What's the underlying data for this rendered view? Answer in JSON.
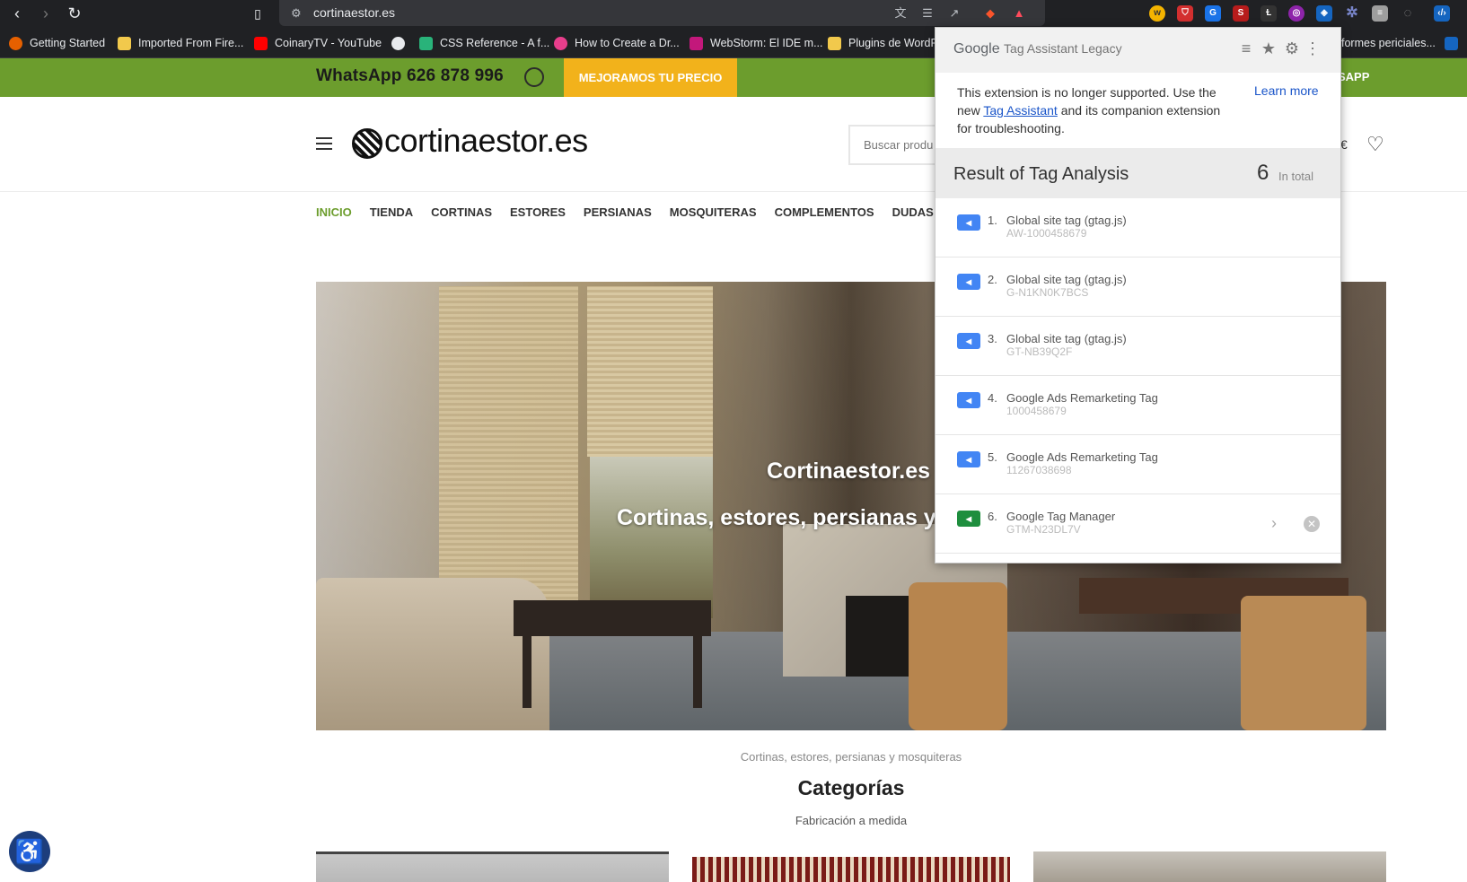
{
  "browser": {
    "url": "cortinaestor.es",
    "bookmarks": [
      {
        "label": "Getting Started",
        "color": "#e66000"
      },
      {
        "label": "Imported From Fire...",
        "color": "#f2c94c"
      },
      {
        "label": "CoinaryTV - YouTube",
        "color": "#ff0000"
      },
      {
        "label": "",
        "color": "#e8eaed"
      },
      {
        "label": "CSS Reference - A f...",
        "color": "#29b37a"
      },
      {
        "label": "How to Create a Dr...",
        "color": "#e83e8c"
      },
      {
        "label": "WebStorm: El IDE m...",
        "color": "#c3187b"
      },
      {
        "label": "Plugins de WordP",
        "color": "#f2c94c"
      },
      {
        "label": "formes periciales...",
        "color": "#f2c94c"
      }
    ]
  },
  "site": {
    "whatsapp": "WhatsApp 626 878 996",
    "price_button": "MEJORAMOS TU PRECIO",
    "top_right": "SAPP",
    "logo": "cortinaestor.es",
    "search_placeholder": "Buscar produ",
    "cart_text": "€",
    "menu": [
      "INICIO",
      "TIENDA",
      "CORTINAS",
      "ESTORES",
      "PERSIANAS",
      "MOSQUITERAS",
      "COMPLEMENTOS",
      "DUDAS"
    ],
    "hero_title": "Cortinaestor.es",
    "hero_subtitle": "Cortinas, estores, persianas y",
    "categories_kicker": "Cortinas, estores, persianas y mosquiteras",
    "categories_title": "Categorías",
    "categories_subtitle": "Fabricación a medida",
    "accent_color": "#6c9d2d"
  },
  "popup": {
    "brand": "Google",
    "product": "Tag Assistant Legacy",
    "notice_before": "This extension is no longer supported. Use the new ",
    "notice_link": "Tag Assistant",
    "notice_after": " and its companion extension for troubleshooting.",
    "learn_more": "Learn more",
    "result_title": "Result of Tag Analysis",
    "result_count": "6",
    "result_total_label": "In total",
    "tags": [
      {
        "num": "1.",
        "name": "Global site tag (gtag.js)",
        "id": "AW-1000458679",
        "color": "#4285f4",
        "icon": "tag-icon"
      },
      {
        "num": "2.",
        "name": "Global site tag (gtag.js)",
        "id": "G-N1KN0K7BCS",
        "color": "#4285f4",
        "icon": "tag-icon"
      },
      {
        "num": "3.",
        "name": "Global site tag (gtag.js)",
        "id": "GT-NB39Q2F",
        "color": "#4285f4",
        "icon": "tag-icon"
      },
      {
        "num": "4.",
        "name": "Google Ads Remarketing Tag",
        "id": "1000458679",
        "color": "#4285f4",
        "icon": "tag-icon"
      },
      {
        "num": "5.",
        "name": "Google Ads Remarketing Tag",
        "id": "11267038698",
        "color": "#4285f4",
        "icon": "tag-icon"
      },
      {
        "num": "6.",
        "name": "Google Tag Manager",
        "id": "GTM-N23DL7V",
        "color": "#1e8e3e",
        "icon": "tag-icon"
      }
    ]
  }
}
